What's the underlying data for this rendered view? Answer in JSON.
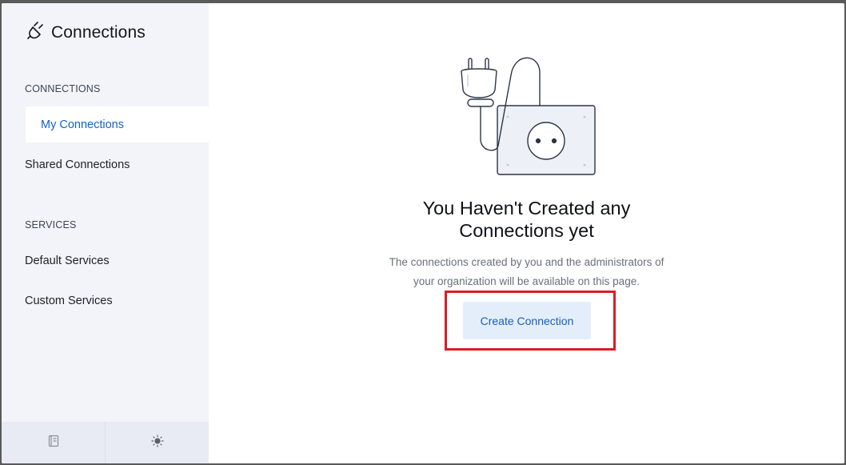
{
  "app": {
    "title": "Connections",
    "icon": "plug-icon"
  },
  "sidebar": {
    "sections": [
      {
        "label": "CONNECTIONS",
        "items": [
          {
            "label": "My Connections",
            "active": true
          },
          {
            "label": "Shared Connections",
            "active": false
          }
        ]
      },
      {
        "label": "SERVICES",
        "items": [
          {
            "label": "Default Services",
            "active": false
          },
          {
            "label": "Custom Services",
            "active": false
          }
        ]
      }
    ],
    "footer": {
      "left_icon": "notebook-icon",
      "right_icon": "sun-icon"
    }
  },
  "main": {
    "empty_state": {
      "illustration": "plug-socket-illustration",
      "title_line1": "You Haven't Created any",
      "title_line2": "Connections yet",
      "description_line1": "The connections created by you and the administrators of",
      "description_line2": "your organization will be available on this page.",
      "button_label": "Create Connection"
    }
  },
  "colors": {
    "accent": "#1463c8",
    "sidebar_bg": "#f2f4f9",
    "button_bg": "#e4eefb",
    "highlight": "#dc1c24"
  }
}
